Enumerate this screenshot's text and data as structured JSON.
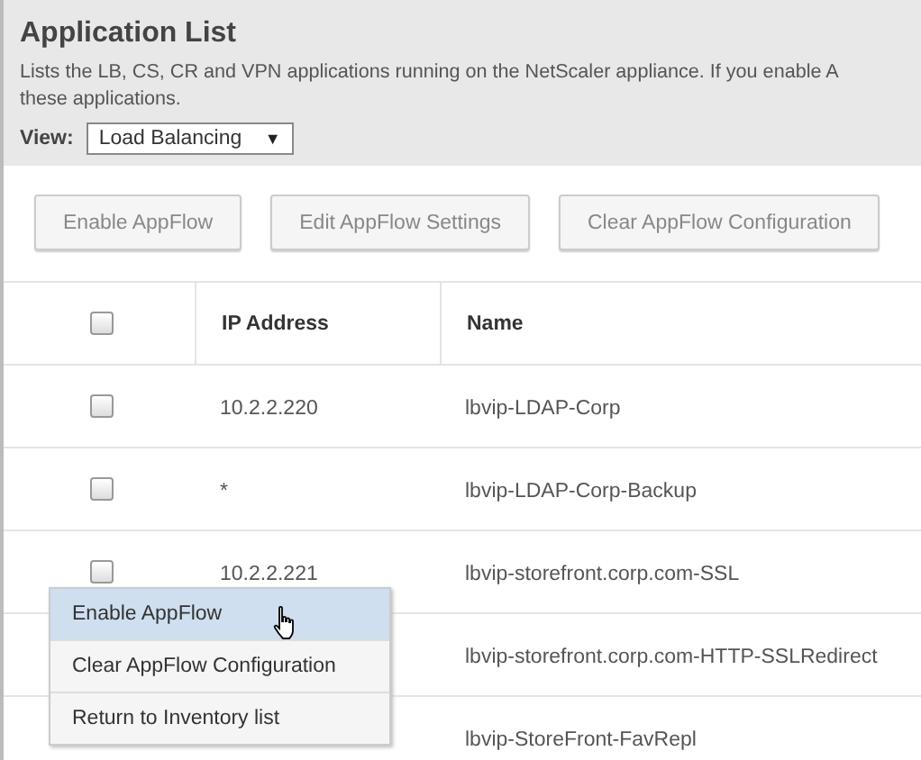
{
  "header": {
    "title": "Application List",
    "description": "Lists the LB, CS, CR and VPN applications running on the NetScaler appliance. If you enable A",
    "description_line2": "these applications.",
    "view_label": "View:",
    "view_value": "Load Balancing",
    "view_caret": "▼"
  },
  "buttons": [
    "Enable AppFlow",
    "Edit AppFlow Settings",
    "Clear AppFlow Configuration"
  ],
  "table": {
    "select_all": {
      "checked": false
    },
    "columns": [
      "IP Address",
      "Name"
    ],
    "rows": [
      {
        "ip": "10.2.2.220",
        "name": "lbvip-LDAP-Corp",
        "checked": false
      },
      {
        "ip": "*",
        "name": "lbvip-LDAP-Corp-Backup",
        "checked": false
      },
      {
        "ip": "10.2.2.221",
        "name": "lbvip-storefront.corp.com-SSL",
        "checked": false
      },
      {
        "name": "lbvip-storefront.corp.com-HTTP-SSLRedirect"
      },
      {
        "name": "lbvip-StoreFront-FavRepl"
      }
    ]
  },
  "context_menu": [
    {
      "label": "Enable AppFlow",
      "selected": true
    },
    {
      "label": "Clear AppFlow Configuration",
      "selected": false
    },
    {
      "label": "Return to Inventory list",
      "selected": false
    }
  ]
}
